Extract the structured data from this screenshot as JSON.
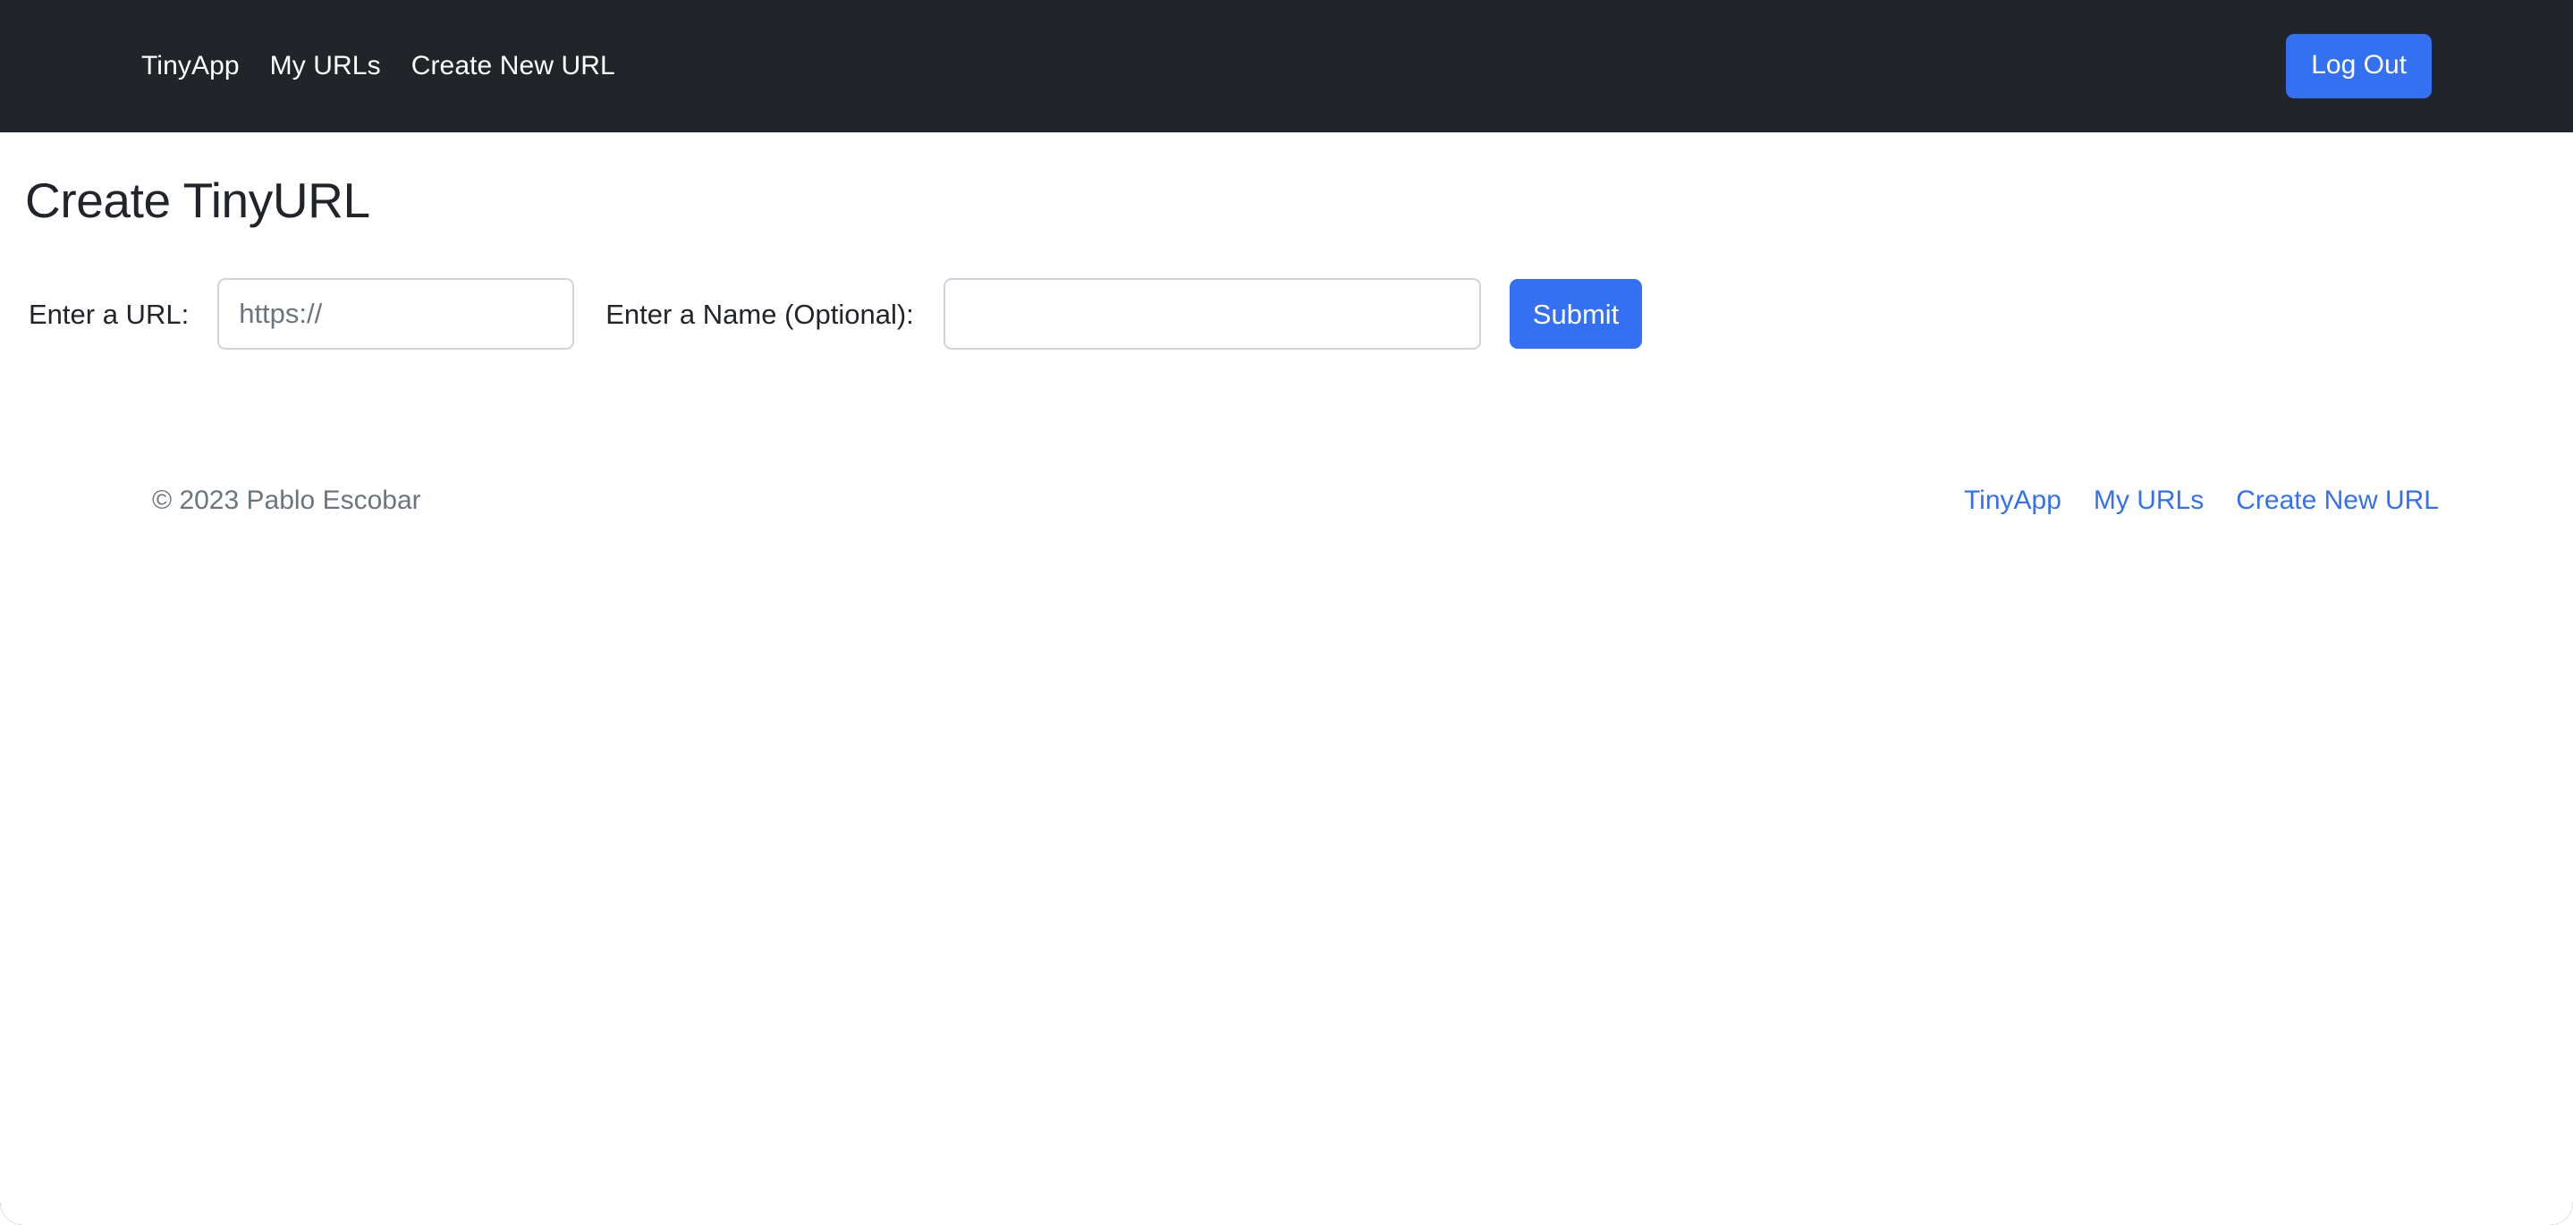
{
  "window": {
    "backdrop_color": "#1b1f23"
  },
  "theme": {
    "navbar_bg": "#212529",
    "accent_blue": "#3370f2",
    "body_bg": "#ffffff",
    "muted_text": "#6c757d",
    "dark_text": "#212529",
    "input_border": "#ced4da"
  },
  "navbar": {
    "brand": "TinyApp",
    "links": [
      {
        "label": "My URLs"
      },
      {
        "label": "Create New URL"
      }
    ],
    "logout_label": "Log Out"
  },
  "main": {
    "title": "Create TinyURL",
    "form": {
      "url_label": "Enter a URL:",
      "url_placeholder": "https://",
      "url_value": "",
      "name_label": "Enter a Name (Optional):",
      "name_placeholder": "",
      "name_value": "",
      "submit_label": "Submit"
    }
  },
  "footer": {
    "copyright": "© 2023 Pablo Escobar",
    "links": [
      {
        "label": "TinyApp"
      },
      {
        "label": "My URLs"
      },
      {
        "label": "Create New URL"
      }
    ]
  }
}
